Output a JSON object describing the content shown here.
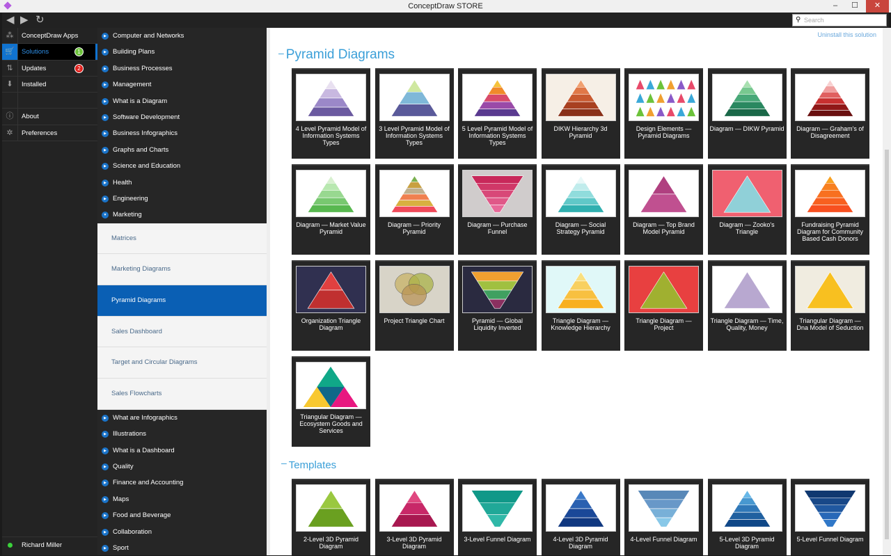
{
  "window": {
    "title": "ConceptDraw STORE",
    "minimize": "–",
    "maximize": "☐",
    "close": "✕"
  },
  "toolbar": {
    "back": "◀",
    "forward": "▶",
    "refresh": "↻",
    "search_placeholder": "Search",
    "search_icon": "⚲"
  },
  "leftnav": [
    {
      "label": "ConceptDraw Apps",
      "icon": "apps-icon",
      "glyph": "⁂"
    },
    {
      "label": "Solutions",
      "icon": "cart-icon",
      "glyph": "🛒",
      "badge": "1",
      "badge_color": "#6cc23a",
      "selected": true
    },
    {
      "label": "Updates",
      "icon": "updates-icon",
      "glyph": "⇅",
      "badge": "2",
      "badge_color": "#e0201c"
    },
    {
      "label": "Installed",
      "icon": "download-icon",
      "glyph": "⬇"
    },
    {
      "label": "",
      "icon": "",
      "glyph": ""
    },
    {
      "label": "About",
      "icon": "info-icon",
      "glyph": "ⓘ"
    },
    {
      "label": "Preferences",
      "icon": "gear-icon",
      "glyph": "✲"
    }
  ],
  "user": {
    "name": "Richard Miller"
  },
  "categories_top": [
    "Computer and Networks",
    "Building Plans",
    "Business Processes",
    "Management",
    "What is a Diagram",
    "Software Development",
    "Business Infographics",
    "Graphs and Charts",
    "Science and Education",
    "Health",
    "Engineering",
    "Marketing"
  ],
  "subcategories": [
    "Matrices",
    "Marketing Diagrams",
    "Pyramid Diagrams",
    "Sales Dashboard",
    "Target and Circular Diagrams",
    "Sales Flowcharts"
  ],
  "selected_subcategory": "Pyramid Diagrams",
  "categories_bottom": [
    "What are Infographics",
    "Illustrations",
    "What is a Dashboard",
    "Quality",
    "Finance and Accounting",
    "Maps",
    "Food and Beverage",
    "Collaboration",
    "Sport"
  ],
  "content": {
    "uninstall": "Uninstall this solution",
    "section_title": "Pyramid Diagrams",
    "templates_title": "Templates",
    "examples": [
      {
        "label": "4 Level Pyramid Model of Information Systems Types",
        "shape": "pyramid",
        "bg": "#ffffff",
        "colors": [
          "#e8e0f0",
          "#c8b8e0",
          "#9b88c8",
          "#6b5aa0"
        ]
      },
      {
        "label": "3 Level Pyramid Model of Information Systems Types",
        "shape": "pyramid",
        "bg": "#ffffff",
        "colors": [
          "#cfe8a0",
          "#7fb8d8",
          "#5a5a9a"
        ]
      },
      {
        "label": "5 Level Pyramid Model of Information Systems Types",
        "shape": "pyramid",
        "bg": "#ffffff",
        "colors": [
          "#f6c23a",
          "#f08a2a",
          "#d84a6a",
          "#9a4aa8",
          "#5a3a90"
        ]
      },
      {
        "label": "DIKW Hierarchy 3d Pyramid",
        "shape": "pyramid",
        "bg": "#f6efe6",
        "colors": [
          "#f0a070",
          "#e07848",
          "#c85a30",
          "#a84020",
          "#8a3018"
        ]
      },
      {
        "label": "Design Elements — Pyramid Diagrams",
        "shape": "multi",
        "bg": "#ffffff",
        "colors": [
          "#e84a6a",
          "#3aa8d8",
          "#6cc23a",
          "#f0a030",
          "#8a5ac8"
        ]
      },
      {
        "label": "Diagram — DIKW Pyramid",
        "shape": "pyramid",
        "bg": "#ffffff",
        "colors": [
          "#a8e0b0",
          "#78c890",
          "#48a878",
          "#2a8860",
          "#1a6848"
        ]
      },
      {
        "label": "Diagram — Graham's of Disagreement",
        "shape": "pyramid",
        "bg": "#ffffff",
        "colors": [
          "#f8d0d0",
          "#f0a0a0",
          "#e06060",
          "#c83030",
          "#901818",
          "#6a1010"
        ]
      },
      {
        "label": "Diagram — Market Value Pyramid",
        "shape": "pyramid",
        "bg": "#ffffff",
        "colors": [
          "#d8f0d0",
          "#b8e8b0",
          "#98d890",
          "#78c870",
          "#58b850"
        ]
      },
      {
        "label": "Diagram — Priority Pyramid",
        "shape": "pyramid",
        "bg": "#ffffff",
        "colors": [
          "#7ab050",
          "#c8a040",
          "#c0b090",
          "#f08050",
          "#d8b040",
          "#f04a5a"
        ]
      },
      {
        "label": "Diagram — Purchase Funnel",
        "shape": "funnel",
        "bg": "#d0cccc",
        "colors": [
          "#c8285a",
          "#d03868",
          "#d84878",
          "#e05888",
          "#e86898"
        ]
      },
      {
        "label": "Diagram — Social Strategy Pyramid",
        "shape": "pyramid",
        "bg": "#ffffff",
        "colors": [
          "#e8f8f8",
          "#c0ecec",
          "#90dcdc",
          "#60c8c8",
          "#30b0b0"
        ]
      },
      {
        "label": "Diagram — Top Brand Model Pyramid",
        "shape": "pyramid",
        "bg": "#ffffff",
        "colors": [
          "#b04080",
          "#c05090"
        ]
      },
      {
        "label": "Diagram — Zooko's Triangle",
        "shape": "pyramid",
        "bg": "#f06070",
        "colors": [
          "#90d0d8"
        ]
      },
      {
        "label": "Fundraising Pyramid Diagram for Community Based Cash Donors",
        "shape": "pyramid",
        "bg": "#ffffff",
        "colors": [
          "#f8a020",
          "#f88020",
          "#f87020",
          "#f86020",
          "#f85020"
        ]
      },
      {
        "label": "Organization Triangle Diagram",
        "shape": "pyramid",
        "bg": "#303050",
        "colors": [
          "#e04040",
          "#c03030"
        ]
      },
      {
        "label": "Project Triangle Chart",
        "shape": "venn",
        "bg": "#d8d4c8",
        "colors": [
          "#c8b060",
          "#a8b040",
          "#b89050"
        ]
      },
      {
        "label": "Pyramid — Global Liquidity Inverted",
        "shape": "funnel",
        "bg": "#2a2a40",
        "colors": [
          "#f0a030",
          "#a0c040",
          "#40a060",
          "#8a3060"
        ]
      },
      {
        "label": "Triangle Diagram — Knowledge Hierarchy",
        "shape": "pyramid",
        "bg": "#e0f8f8",
        "colors": [
          "#f8e080",
          "#f8d060",
          "#f8c040",
          "#f8b020"
        ]
      },
      {
        "label": "Triangle Diagram — Project",
        "shape": "pyramid",
        "bg": "#e84040",
        "colors": [
          "#a0b030"
        ]
      },
      {
        "label": "Triangle Diagram — Time, Quality, Money",
        "shape": "pyramid",
        "bg": "#ffffff",
        "colors": [
          "#b8a8d0"
        ]
      },
      {
        "label": "Triangular Diagram — Dna Model of Seduction",
        "shape": "pyramid",
        "bg": "#f0ece0",
        "colors": [
          "#f8c020"
        ]
      },
      {
        "label": "Triangular Diagram — Ecosystem Goods and Services",
        "shape": "multi3",
        "bg": "#ffffff",
        "colors": [
          "#10a888",
          "#f8c830",
          "#106888",
          "#e81880"
        ]
      }
    ],
    "templates": [
      {
        "label": "2-Level 3D Pyramid Diagram",
        "shape": "pyramid",
        "bg": "#ffffff",
        "colors": [
          "#9ac840",
          "#6aa020"
        ]
      },
      {
        "label": "3-Level 3D Pyramid Diagram",
        "shape": "pyramid",
        "bg": "#ffffff",
        "colors": [
          "#e04880",
          "#c82868",
          "#a81850"
        ]
      },
      {
        "label": "3-Level Funnel Diagram",
        "shape": "funnel",
        "bg": "#ffffff",
        "colors": [
          "#109888",
          "#20a898",
          "#30b8a8"
        ]
      },
      {
        "label": "4-Level 3D Pyramid Diagram",
        "shape": "pyramid",
        "bg": "#ffffff",
        "colors": [
          "#3a78c8",
          "#2a60b0",
          "#1a4898",
          "#103880"
        ]
      },
      {
        "label": "4-Level Funnel Diagram",
        "shape": "funnel",
        "bg": "#ffffff",
        "colors": [
          "#5888b8",
          "#6898c8",
          "#78b0d8",
          "#88c8e8"
        ]
      },
      {
        "label": "5-Level 3D Pyramid Diagram",
        "shape": "pyramid",
        "bg": "#ffffff",
        "colors": [
          "#68b8e8",
          "#4898d0",
          "#3078b8",
          "#2060a0",
          "#104888"
        ]
      },
      {
        "label": "5-Level Funnel Diagram",
        "shape": "funnel",
        "bg": "#ffffff",
        "colors": [
          "#103870",
          "#184888",
          "#2058a0",
          "#2868b8",
          "#3078c8"
        ]
      }
    ]
  }
}
